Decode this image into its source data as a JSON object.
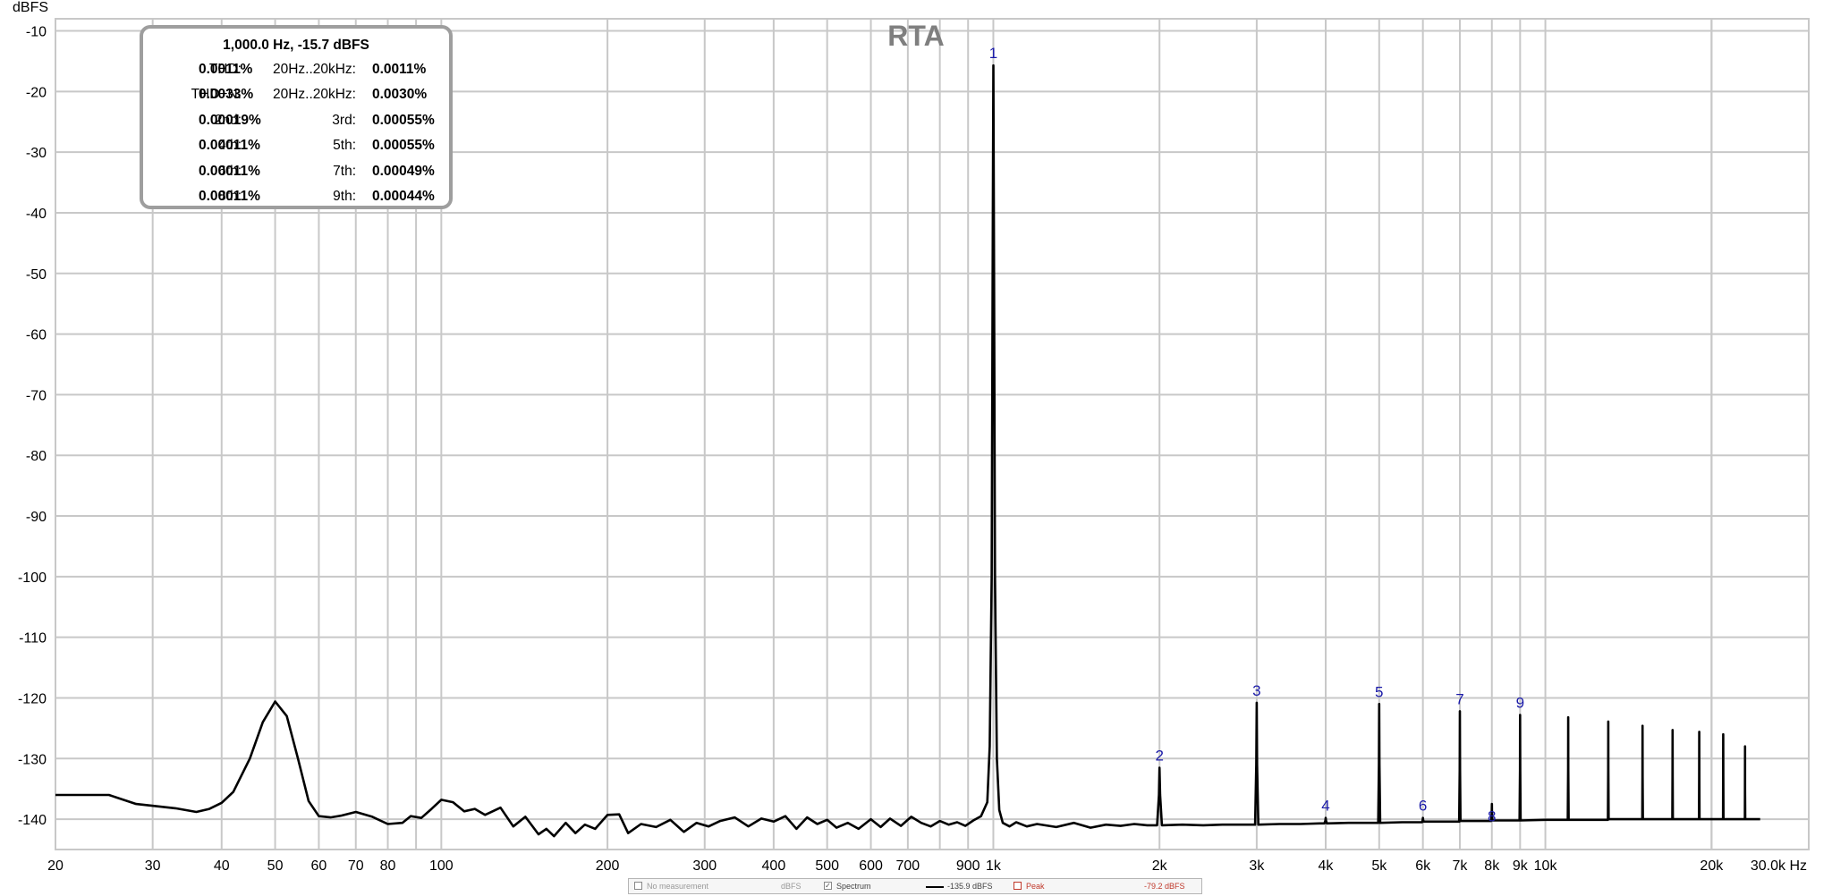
{
  "chart_data": {
    "type": "line",
    "title": "RTA",
    "ylabel": "dBFS",
    "xlabel": "Hz",
    "x_scale": "log",
    "xlim": [
      20,
      30000
    ],
    "ylim": [
      -145,
      -8
    ],
    "grid": true,
    "y_ticks": [
      -10,
      -20,
      -30,
      -40,
      -50,
      -60,
      -70,
      -80,
      -90,
      -100,
      -110,
      -120,
      -130,
      -140
    ],
    "y_tick_labels": [
      "-10",
      "-20",
      "-30",
      "-40",
      "-50",
      "-60",
      "-70",
      "-80",
      "-90",
      "-100",
      "-110",
      "-120",
      "-130",
      "-140"
    ],
    "x_ticks": [
      20,
      30,
      40,
      50,
      60,
      70,
      80,
      100,
      200,
      300,
      400,
      500,
      600,
      700,
      900,
      1000,
      2000,
      3000,
      4000,
      5000,
      6000,
      7000,
      8000,
      9000,
      10000,
      20000,
      30000
    ],
    "x_tick_labels": [
      "20",
      "30",
      "40",
      "50",
      "60",
      "70",
      "80",
      "100",
      "200",
      "300",
      "400",
      "500",
      "600",
      "700",
      "900",
      "1k",
      "2k",
      "3k",
      "4k",
      "5k",
      "6k",
      "7k",
      "8k",
      "9k",
      "10k",
      "20k",
      "30.0k Hz"
    ],
    "series": [
      {
        "name": "Spectrum",
        "color": "#000000",
        "points": [
          [
            20,
            -136
          ],
          [
            25,
            -136
          ],
          [
            28,
            -137.5
          ],
          [
            33,
            -138.2
          ],
          [
            36,
            -138.8
          ],
          [
            38,
            -138.3
          ],
          [
            40,
            -137.3
          ],
          [
            42,
            -135.5
          ],
          [
            45,
            -130
          ],
          [
            47.5,
            -124
          ],
          [
            50,
            -120.6
          ],
          [
            52.5,
            -123
          ],
          [
            55,
            -130
          ],
          [
            57.5,
            -137
          ],
          [
            60,
            -139.5
          ],
          [
            63,
            -139.7
          ],
          [
            66,
            -139.4
          ],
          [
            70,
            -138.8
          ],
          [
            75,
            -139.6
          ],
          [
            80,
            -140.8
          ],
          [
            85,
            -140.6
          ],
          [
            88,
            -139.5
          ],
          [
            92,
            -139.8
          ],
          [
            96,
            -138.3
          ],
          [
            100,
            -136.8
          ],
          [
            105,
            -137.2
          ],
          [
            110,
            -138.7
          ],
          [
            115,
            -138.3
          ],
          [
            120,
            -139.3
          ],
          [
            128,
            -138.1
          ],
          [
            135,
            -141.2
          ],
          [
            142,
            -139.6
          ],
          [
            150,
            -142.5
          ],
          [
            155,
            -141.6
          ],
          [
            160,
            -142.8
          ],
          [
            168,
            -140.6
          ],
          [
            175,
            -142.3
          ],
          [
            182,
            -140.9
          ],
          [
            190,
            -141.6
          ],
          [
            200,
            -139.3
          ],
          [
            210,
            -139.2
          ],
          [
            218,
            -142.3
          ],
          [
            230,
            -140.8
          ],
          [
            245,
            -141.3
          ],
          [
            260,
            -140.1
          ],
          [
            275,
            -142.1
          ],
          [
            290,
            -140.6
          ],
          [
            305,
            -141.2
          ],
          [
            320,
            -140.3
          ],
          [
            340,
            -139.7
          ],
          [
            360,
            -141.2
          ],
          [
            380,
            -139.9
          ],
          [
            400,
            -140.4
          ],
          [
            420,
            -139.5
          ],
          [
            440,
            -141.6
          ],
          [
            460,
            -139.7
          ],
          [
            480,
            -140.8
          ],
          [
            500,
            -140.1
          ],
          [
            520,
            -141.4
          ],
          [
            545,
            -140.6
          ],
          [
            570,
            -141.6
          ],
          [
            600,
            -140.0
          ],
          [
            625,
            -141.3
          ],
          [
            650,
            -139.9
          ],
          [
            680,
            -141.1
          ],
          [
            710,
            -139.6
          ],
          [
            740,
            -140.6
          ],
          [
            770,
            -141.2
          ],
          [
            800,
            -140.3
          ],
          [
            830,
            -140.9
          ],
          [
            860,
            -140.5
          ],
          [
            890,
            -141.1
          ],
          [
            920,
            -140.2
          ],
          [
            950,
            -139.5
          ],
          [
            975,
            -137.2
          ],
          [
            985,
            -128
          ],
          [
            993,
            -100
          ],
          [
            998,
            -40
          ],
          [
            1000,
            -15.7
          ],
          [
            1002,
            -38
          ],
          [
            1007,
            -100
          ],
          [
            1015,
            -130
          ],
          [
            1025,
            -138.5
          ],
          [
            1040,
            -140.6
          ],
          [
            1070,
            -141.2
          ],
          [
            1100,
            -140.5
          ],
          [
            1150,
            -141.2
          ],
          [
            1200,
            -140.8
          ],
          [
            1300,
            -141.3
          ],
          [
            1400,
            -140.6
          ],
          [
            1500,
            -141.4
          ],
          [
            1600,
            -140.9
          ],
          [
            1700,
            -141.1
          ],
          [
            1800,
            -140.8
          ],
          [
            1900,
            -141.0
          ],
          [
            1980,
            -141
          ],
          [
            1995,
            -136
          ],
          [
            2000,
            -131.5
          ],
          [
            2005,
            -136
          ],
          [
            2020,
            -141
          ],
          [
            2200,
            -140.9
          ],
          [
            2400,
            -141
          ],
          [
            2600,
            -140.9
          ],
          [
            2800,
            -140.9
          ],
          [
            2980,
            -140.9
          ],
          [
            2995,
            -131
          ],
          [
            3000,
            -120.8
          ],
          [
            3005,
            -131
          ],
          [
            3020,
            -140.9
          ],
          [
            3300,
            -140.8
          ],
          [
            3600,
            -140.8
          ],
          [
            3900,
            -140.7
          ],
          [
            3980,
            -140.7
          ],
          [
            3995,
            -140.2
          ],
          [
            4000,
            -139.8
          ],
          [
            4005,
            -140.2
          ],
          [
            4020,
            -140.7
          ],
          [
            4400,
            -140.6
          ],
          [
            4800,
            -140.6
          ],
          [
            4980,
            -140.6
          ],
          [
            4995,
            -131
          ],
          [
            5000,
            -121
          ],
          [
            5005,
            -131
          ],
          [
            5020,
            -140.6
          ],
          [
            5500,
            -140.5
          ],
          [
            5980,
            -140.5
          ],
          [
            5995,
            -140.1
          ],
          [
            6000,
            -139.8
          ],
          [
            6005,
            -140.1
          ],
          [
            6020,
            -140.4
          ],
          [
            6500,
            -140.4
          ],
          [
            6980,
            -140.4
          ],
          [
            6995,
            -132
          ],
          [
            7000,
            -122.2
          ],
          [
            7005,
            -132
          ],
          [
            7020,
            -140.3
          ],
          [
            7500,
            -140.3
          ],
          [
            7980,
            -140.3
          ],
          [
            7995,
            -139
          ],
          [
            8000,
            -137.5
          ],
          [
            8005,
            -139
          ],
          [
            8020,
            -140.2
          ],
          [
            8500,
            -140.2
          ],
          [
            8980,
            -140.2
          ],
          [
            8995,
            -132
          ],
          [
            9000,
            -122.8
          ],
          [
            9005,
            -132
          ],
          [
            9020,
            -140.2
          ],
          [
            10000,
            -140.1
          ],
          [
            10980,
            -140.1
          ],
          [
            10995,
            -132
          ],
          [
            11000,
            -123.2
          ],
          [
            11005,
            -132
          ],
          [
            11020,
            -140.1
          ],
          [
            12500,
            -140.1
          ],
          [
            12980,
            -140.1
          ],
          [
            12995,
            -132
          ],
          [
            13000,
            -123.9
          ],
          [
            13005,
            -132
          ],
          [
            13020,
            -140
          ],
          [
            14500,
            -140
          ],
          [
            14980,
            -140
          ],
          [
            14995,
            -133
          ],
          [
            15000,
            -124.6
          ],
          [
            15005,
            -133
          ],
          [
            15020,
            -140
          ],
          [
            16500,
            -140
          ],
          [
            16980,
            -140
          ],
          [
            16995,
            -133
          ],
          [
            17000,
            -125.3
          ],
          [
            17005,
            -133
          ],
          [
            17020,
            -140
          ],
          [
            18500,
            -140
          ],
          [
            18980,
            -140
          ],
          [
            18995,
            -133
          ],
          [
            19000,
            -125.6
          ],
          [
            19005,
            -133
          ],
          [
            19020,
            -140
          ],
          [
            20000,
            -140
          ],
          [
            20980,
            -140
          ],
          [
            20995,
            -133
          ],
          [
            21000,
            -126
          ],
          [
            21005,
            -133
          ],
          [
            21020,
            -140
          ],
          [
            22000,
            -140
          ],
          [
            22980,
            -140
          ],
          [
            22995,
            -135
          ],
          [
            23000,
            -128
          ],
          [
            23005,
            -135
          ],
          [
            23020,
            -140
          ],
          [
            24000,
            -140
          ],
          [
            24500,
            -140
          ]
        ]
      }
    ],
    "harmonic_markers": [
      {
        "label": "1",
        "x": 1000,
        "y": -15.7
      },
      {
        "label": "2",
        "x": 2000,
        "y": -131.5
      },
      {
        "label": "3",
        "x": 3000,
        "y": -120.8
      },
      {
        "label": "4",
        "x": 4000,
        "y": -139.8
      },
      {
        "label": "5",
        "x": 5000,
        "y": -121
      },
      {
        "label": "6",
        "x": 6000,
        "y": -139.8
      },
      {
        "label": "7",
        "x": 7000,
        "y": -122.2
      },
      {
        "label": "8",
        "x": 8000,
        "y": -141.5
      },
      {
        "label": "9",
        "x": 9000,
        "y": -122.8
      }
    ]
  },
  "stats": {
    "header": "1,000.0 Hz, -15.7 dBFS",
    "rows": [
      {
        "l1": "THD:",
        "v1": "0.0011%",
        "l2": "20Hz..20kHz:",
        "v2": "0.0011%"
      },
      {
        "l1": "THD+N:",
        "v1": "0.0033%",
        "l2": "20Hz..20kHz:",
        "v2": "0.0030%"
      },
      {
        "l1": "2nd:",
        "v1": "0.00019%",
        "l2": "3rd:",
        "v2": "0.00055%"
      },
      {
        "l1": "4th:",
        "v1": "0.00011%",
        "l2": "5th:",
        "v2": "0.00055%"
      },
      {
        "l1": "6th:",
        "v1": "0.00011%",
        "l2": "7th:",
        "v2": "0.00049%"
      },
      {
        "l1": "8th:",
        "v1": "0.00011%",
        "l2": "9th:",
        "v2": "0.00044%"
      }
    ]
  },
  "legend": {
    "no_measurement": "No measurement",
    "unit": "dBFS",
    "spectrum_label": "Spectrum",
    "spectrum_value": "-135.9 dBFS",
    "peak_label": "Peak",
    "peak_value": "-79.2 dBFS",
    "peak_color": "#c0392b"
  }
}
